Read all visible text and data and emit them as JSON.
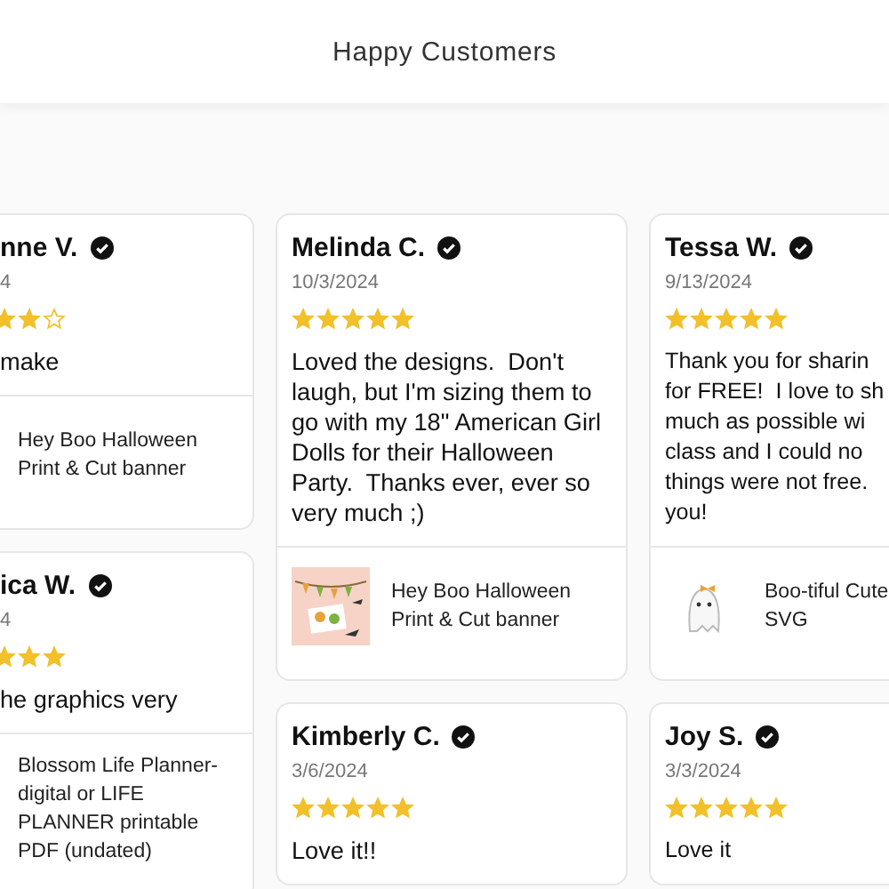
{
  "header": {
    "title": "Happy Customers"
  },
  "columns": [
    {
      "cards": [
        {
          "name": "nne V.",
          "date": "4",
          "stars": 2,
          "text": "make",
          "product": {
            "title": "Hey Boo Halloween Print & Cut banner"
          }
        },
        {
          "name": "ica W.",
          "date": "4",
          "stars": 3,
          "text": "he graphics very",
          "product": {
            "title": "Blossom Life Planner- digital or LIFE PLANNER printable PDF (undated)"
          }
        }
      ]
    },
    {
      "cards": [
        {
          "name": "Melinda C.",
          "date": "10/3/2024",
          "stars": 5,
          "text": "Loved the designs.  Don't laugh, but I'm sizing them to go with my 18\" American Girl Dolls for their Halloween Party.  Thanks ever, ever so very much ;)",
          "product": {
            "title": "Hey Boo Halloween Print & Cut banner"
          }
        },
        {
          "name": "Kimberly C.",
          "date": "3/6/2024",
          "stars": 5,
          "text": "Love it!!"
        }
      ]
    },
    {
      "cards": [
        {
          "name": "Tessa W.",
          "date": "9/13/2024",
          "stars": 5,
          "text": "Thank you for sharin\nfor FREE!  I love to sh\nmuch as possible wi\nclass and I could no\nthings were not free.\nyou!",
          "product": {
            "title": "Boo-tiful Cute\nSVG"
          }
        },
        {
          "name": "Joy S.",
          "date": "3/3/2024",
          "stars": 5,
          "text": "Love it"
        }
      ]
    }
  ]
}
